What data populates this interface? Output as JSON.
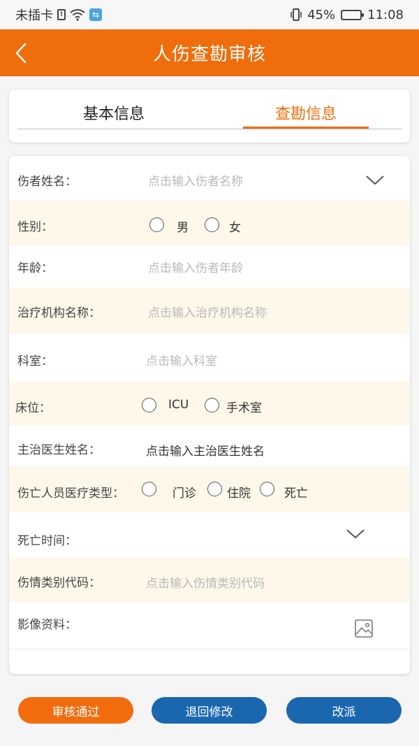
{
  "status_bar": {
    "carrier": "未插卡",
    "battery": "45%",
    "battery_level": 0.45,
    "time": "11:08"
  },
  "header": {
    "title": "人伤查勘审核",
    "back_icon": "chevron-left-icon"
  },
  "tabs": [
    {
      "label": "基本信息",
      "active": false
    },
    {
      "label": "查勘信息",
      "active": true
    }
  ],
  "form": {
    "injured_name": {
      "label": "伤者姓名：",
      "placeholder": "点击输入伤者名称"
    },
    "gender": {
      "label": "性别：",
      "options": [
        "男",
        "女"
      ]
    },
    "age": {
      "label": "年龄：",
      "placeholder": "点击输入伤者年龄"
    },
    "institution": {
      "label": "治疗机构名称：",
      "placeholder": "点击输入治疗机构名称"
    },
    "department": {
      "label": "科室：",
      "placeholder": "点击输入科室"
    },
    "bed": {
      "label": "床位：",
      "options": [
        "ICU",
        "手术室"
      ]
    },
    "doctor": {
      "label": "主治医生姓名：",
      "placeholder": "点击输入主治医生姓名"
    },
    "medical_type": {
      "label": "伤亡人员医疗类型：",
      "options": [
        "门诊",
        "住院",
        "死亡"
      ]
    },
    "death_time": {
      "label": "死亡时间："
    },
    "injury_code": {
      "label": "伤情类别代码：",
      "placeholder": "点击输入伤情类别代码"
    },
    "images": {
      "label": "影像资料：",
      "icon": "image-icon"
    }
  },
  "actions": {
    "approve": "审核通过",
    "return": "退回修改",
    "reassign": "改派"
  },
  "colors": {
    "accent": "#ef6d0b",
    "blue": "#1a67b0",
    "alt_row": "#fdf8ea"
  }
}
